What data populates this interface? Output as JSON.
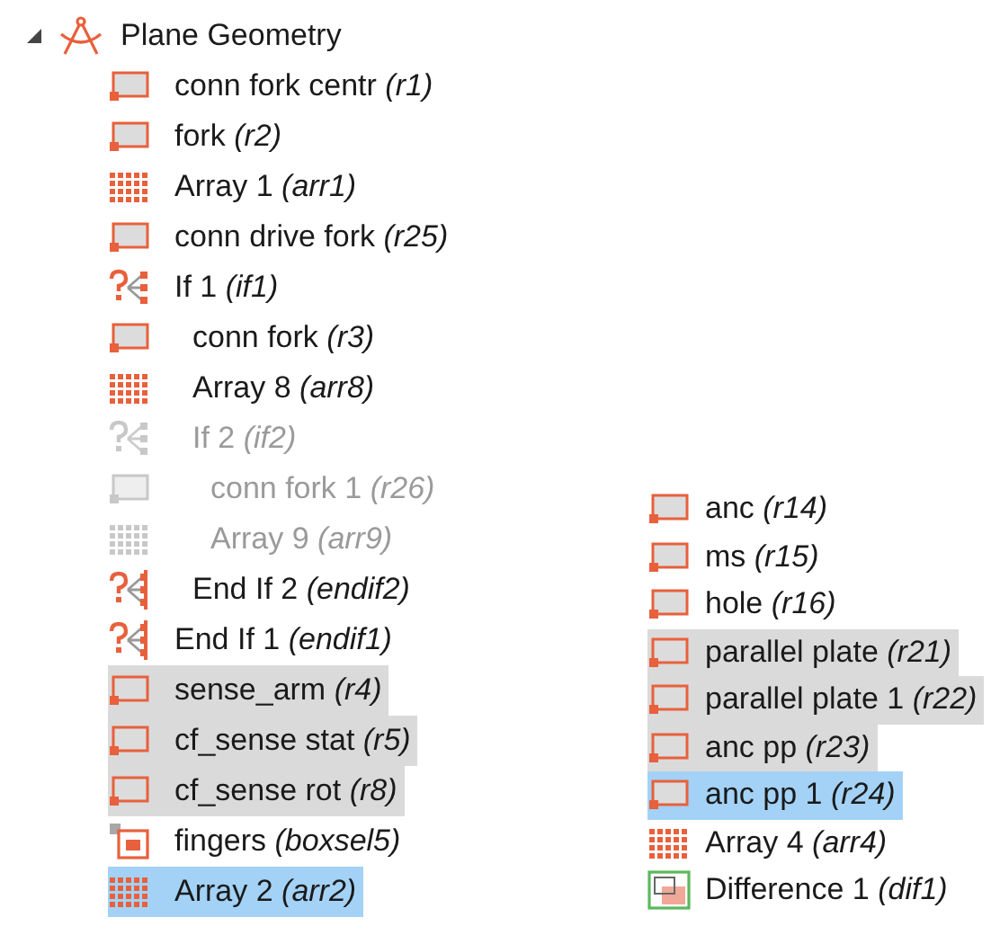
{
  "tree": {
    "label": "Plane Geometry",
    "expanded": true,
    "children": [
      {
        "kind": "rectangle",
        "label": "conn fork centr *(r1)*",
        "selected": false,
        "highlighted": false,
        "disabled": false
      },
      {
        "kind": "rectangle",
        "label": "fork *(r2)*",
        "selected": false,
        "highlighted": false,
        "disabled": false
      },
      {
        "kind": "array",
        "label": "Array 1 *(arr1)*",
        "selected": false,
        "highlighted": false,
        "disabled": false
      },
      {
        "kind": "rectangle",
        "label": "conn drive fork *(r25)*",
        "selected": false,
        "highlighted": false,
        "disabled": false
      },
      {
        "kind": "if",
        "label": "If 1 *(if1)*",
        "selected": false,
        "highlighted": false,
        "disabled": false,
        "children": [
          {
            "kind": "rectangle",
            "label": "conn fork *(r3)*",
            "selected": false,
            "highlighted": false,
            "disabled": false
          },
          {
            "kind": "array",
            "label": "Array 8 *(arr8)*",
            "selected": false,
            "highlighted": false,
            "disabled": false
          },
          {
            "kind": "if",
            "label": "If 2 *(if2)*",
            "selected": false,
            "highlighted": false,
            "disabled": true,
            "children": [
              {
                "kind": "rectangle",
                "label": "conn fork 1 *(r26)*",
                "selected": false,
                "highlighted": false,
                "disabled": true
              },
              {
                "kind": "array",
                "label": "Array 9 *(arr9)*",
                "selected": false,
                "highlighted": false,
                "disabled": true
              }
            ]
          },
          {
            "kind": "endif",
            "label": "End If 2 *(endif2)*",
            "selected": false,
            "highlighted": false,
            "disabled": false
          }
        ]
      },
      {
        "kind": "endif",
        "label": "End If 1 *(endif1)*",
        "selected": false,
        "highlighted": false,
        "disabled": false
      },
      {
        "kind": "rectangle",
        "label": "sense_arm *(r4)*",
        "selected": false,
        "highlighted": true,
        "disabled": false
      },
      {
        "kind": "rectangle",
        "label": "cf_sense stat *(r5)*",
        "selected": false,
        "highlighted": true,
        "disabled": false
      },
      {
        "kind": "rectangle",
        "label": "cf_sense rot *(r8)*",
        "selected": false,
        "highlighted": true,
        "disabled": false
      },
      {
        "kind": "selection",
        "label": "fingers *(boxsel5)*",
        "selected": false,
        "highlighted": false,
        "disabled": false
      },
      {
        "kind": "array",
        "label": "Array 2 *(arr2)*",
        "selected": true,
        "highlighted": false,
        "disabled": false
      }
    ]
  },
  "tree_2": {
    "items": [
      {
        "kind": "rectangle",
        "label": "anc *(r14)*",
        "selected": false,
        "highlighted": false,
        "disabled": false
      },
      {
        "kind": "rectangle",
        "label": "ms *(r15)*",
        "selected": false,
        "highlighted": false,
        "disabled": false
      },
      {
        "kind": "rectangle",
        "label": "hole *(r16)*",
        "selected": false,
        "highlighted": false,
        "disabled": false
      },
      {
        "kind": "rectangle",
        "label": "parallel plate *(r21)*",
        "selected": false,
        "highlighted": true,
        "disabled": false
      },
      {
        "kind": "rectangle",
        "label": "parallel plate 1 *(r22)*",
        "selected": false,
        "highlighted": true,
        "disabled": false
      },
      {
        "kind": "rectangle",
        "label": "anc pp *(r23)*",
        "selected": false,
        "highlighted": true,
        "disabled": false
      },
      {
        "kind": "rectangle",
        "label": "anc pp 1 *(r24)*",
        "selected": true,
        "highlighted": false,
        "disabled": false
      },
      {
        "kind": "array",
        "label": "Array 4 *(arr4)*",
        "selected": false,
        "highlighted": false,
        "disabled": false
      },
      {
        "kind": "difference",
        "label": "Difference 1 *(dif1)*",
        "selected": false,
        "highlighted": false,
        "disabled": false
      }
    ]
  }
}
